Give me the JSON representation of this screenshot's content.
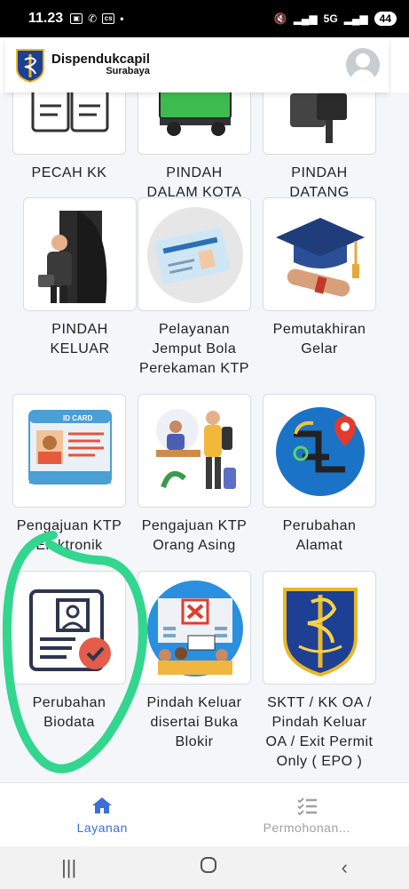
{
  "status_bar": {
    "time": "11.23",
    "battery": "44",
    "network": "5G"
  },
  "header": {
    "app_name": "Dispendukcapil",
    "subtitle": "Surabaya"
  },
  "services": [
    {
      "label": "PECAH KK",
      "icon": "document-split-icon"
    },
    {
      "label": "PINDAH\nDALAM KOTA",
      "icon": "truck-icon"
    },
    {
      "label": "PINDAH\nDATANG",
      "icon": "person-arriving-icon"
    },
    {
      "label": "PINDAH\nKELUAR",
      "icon": "person-leaving-door-icon"
    },
    {
      "label": "Pelayanan\nJemput Bola\nPerekaman KTP",
      "icon": "id-card-pickup-icon"
    },
    {
      "label": "Pemutakhiran\nGelar",
      "icon": "graduation-cap-icon"
    },
    {
      "label": "Pengajuan KTP\nElektronik",
      "icon": "id-card-icon"
    },
    {
      "label": "Pengajuan KTP\nOrang Asing",
      "icon": "foreigner-icon"
    },
    {
      "label": "Perubahan\nAlamat",
      "icon": "map-pin-icon"
    },
    {
      "label": "Perubahan\nBiodata",
      "icon": "profile-check-icon"
    },
    {
      "label": "Pindah Keluar\ndisertai Buka\nBlokir",
      "icon": "protest-building-icon"
    },
    {
      "label": "SKTT / KK OA /\nPindah Keluar\nOA / Exit Permit\nOnly ( EPO )",
      "icon": "surabaya-emblem-icon"
    }
  ],
  "bottom_nav": [
    {
      "label": "Layanan",
      "icon": "home-icon",
      "active": true
    },
    {
      "label": "Permohonan...",
      "icon": "list-check-icon",
      "active": false
    }
  ],
  "colors": {
    "active": "#3a6fd8",
    "inactive": "#a0a0a0",
    "highlight": "#33d68f"
  }
}
